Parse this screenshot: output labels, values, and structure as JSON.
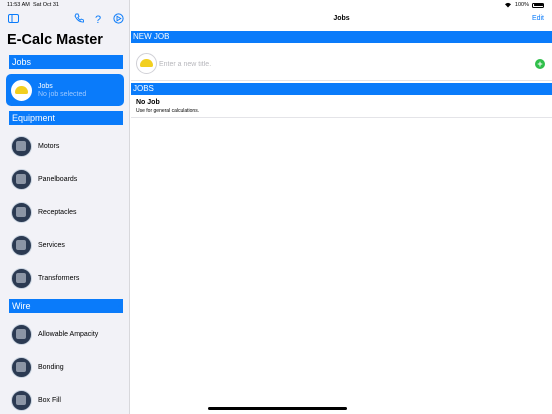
{
  "status": {
    "time": "11:53 AM",
    "date": "Sat Oct 31",
    "battery": "100%"
  },
  "sidebar": {
    "app_title": "E-Calc Master",
    "icons": [
      "sidebar-toggle-icon",
      "phone-icon",
      "help-icon",
      "settings-icon"
    ],
    "help_glyph": "?",
    "sections": [
      {
        "label": "Jobs"
      },
      {
        "label": "Equipment"
      },
      {
        "label": "Wire"
      }
    ],
    "jobs_item": {
      "label": "Jobs",
      "sublabel": "No job selected"
    },
    "equipment_items": [
      {
        "label": "Motors"
      },
      {
        "label": "Panelboards"
      },
      {
        "label": "Receptacles"
      },
      {
        "label": "Services"
      },
      {
        "label": "Transformers"
      }
    ],
    "wire_items": [
      {
        "label": "Allowable Ampacity"
      },
      {
        "label": "Bonding"
      },
      {
        "label": "Box Fill"
      }
    ]
  },
  "main": {
    "nav_title": "Jobs",
    "edit_label": "Edit",
    "new_job_header": "NEW JOB",
    "new_job_placeholder": "Enter a new title.",
    "add_glyph": "+",
    "jobs_header": "JOBS",
    "jobs": [
      {
        "name": "No Job",
        "description": "Use for general calculations."
      }
    ]
  },
  "colors": {
    "accent": "#0a7bfa",
    "add_button": "#2fbf4a",
    "sidebar_bg": "#f2f2f7"
  }
}
